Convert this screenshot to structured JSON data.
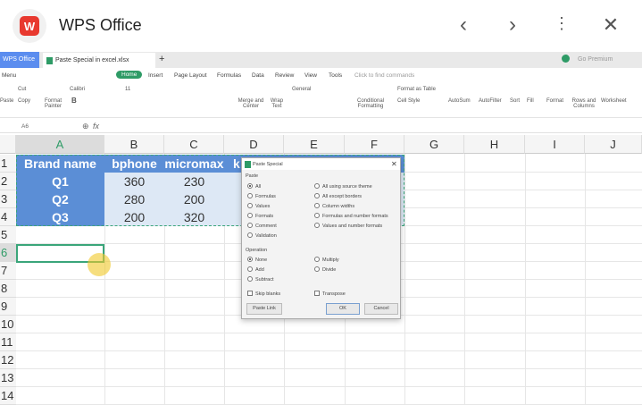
{
  "app": {
    "title": "WPS Office",
    "logo": "W"
  },
  "tabs": {
    "wps": "WPS Office",
    "doc": "Paste Special in excel.xlsx",
    "new": "+",
    "premium": "Go Premium"
  },
  "menu": {
    "menu": "Menu",
    "items": [
      "Home",
      "Insert",
      "Page Layout",
      "Formulas",
      "Data",
      "Review",
      "View",
      "Tools"
    ],
    "search": "Click to find commands"
  },
  "ribbon": {
    "cut": "Cut",
    "copy": "Copy",
    "paste": "Paste",
    "format_painter": "Format Painter",
    "font": "Calibri",
    "size": "11",
    "merge": "Merge and Center",
    "wrap": "Wrap Text",
    "number": "General",
    "cond": "Conditional Formatting",
    "format_table": "Format as Table",
    "cell_style": "Cell Style",
    "autosum": "AutoSum",
    "autofilter": "AutoFilter",
    "sort": "Sort",
    "fill": "Fill",
    "format": "Format",
    "rows_cols": "Rows and Columns",
    "worksheet": "Worksheet"
  },
  "formula_bar": {
    "cell_ref": "A6",
    "fx": "fx"
  },
  "sheet": {
    "columns": [
      "A",
      "B",
      "C",
      "D",
      "E",
      "F",
      "G",
      "H",
      "I",
      "J"
    ],
    "rows": [
      "1",
      "2",
      "3",
      "4",
      "5",
      "6",
      "7",
      "8",
      "9",
      "10",
      "11",
      "12",
      "13",
      "14"
    ],
    "header": [
      "Brand name",
      "bphone",
      "micromax",
      "k"
    ],
    "data": [
      [
        "Q1",
        "360",
        "230"
      ],
      [
        "Q2",
        "280",
        "200"
      ],
      [
        "Q3",
        "200",
        "320"
      ]
    ]
  },
  "dialog": {
    "title": "Paste Special",
    "paste_label": "Paste",
    "paste_left": [
      "All",
      "Formulas",
      "Values",
      "Formats",
      "Comment",
      "Validation"
    ],
    "paste_right": [
      "All using source theme",
      "All except borders",
      "Column widths",
      "Formulas and number formats",
      "Values and number formats"
    ],
    "operation_label": "Operation",
    "op_left": [
      "None",
      "Add",
      "Subtract"
    ],
    "op_right": [
      "Multiply",
      "Divide"
    ],
    "skip_blanks": "Skip blanks",
    "transpose": "Transpose",
    "paste_link": "Paste Link",
    "ok": "OK",
    "cancel": "Cancel"
  },
  "colors": {
    "accent": "#2e9b66",
    "header_fill": "#5b8ed6",
    "value_fill": "#dde8f5"
  }
}
